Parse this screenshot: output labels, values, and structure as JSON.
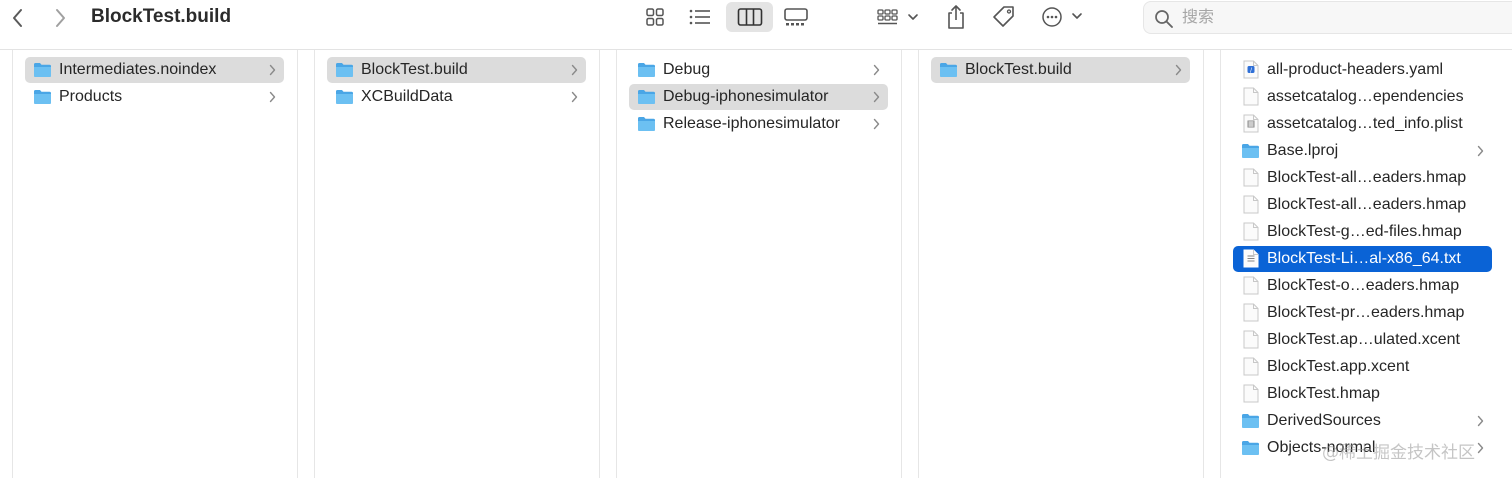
{
  "window": {
    "title": "BlockTest.build"
  },
  "toolbar": {
    "back_icon": "chevron-left-icon",
    "forward_icon": "chevron-right-icon",
    "view_icons": [
      "icon-view-icon",
      "list-view-icon",
      "column-view-icon",
      "gallery-view-icon"
    ],
    "active_view": "column-view-icon",
    "group_icon": "group-by-icon",
    "share_icon": "share-icon",
    "tag_icon": "tag-icon",
    "more_icon": "more-actions-icon"
  },
  "search": {
    "placeholder": "搜索"
  },
  "columns": [
    {
      "items": [
        {
          "label": "Intermediates.noindex",
          "type": "folder",
          "chevron": true,
          "state": "selected-gray"
        },
        {
          "label": "Products",
          "type": "folder",
          "chevron": true,
          "state": "none"
        }
      ]
    },
    {
      "items": [
        {
          "label": "BlockTest.build",
          "type": "folder",
          "chevron": true,
          "state": "selected-gray"
        },
        {
          "label": "XCBuildData",
          "type": "folder",
          "chevron": true,
          "state": "none"
        }
      ]
    },
    {
      "items": [
        {
          "label": "Debug",
          "type": "folder",
          "chevron": true,
          "state": "none"
        },
        {
          "label": "Debug-iphonesimulator",
          "type": "folder",
          "chevron": true,
          "state": "selected-gray"
        },
        {
          "label": "Release-iphonesimulator",
          "type": "folder",
          "chevron": true,
          "state": "none"
        }
      ]
    },
    {
      "items": [
        {
          "label": "BlockTest.build",
          "type": "folder",
          "chevron": true,
          "state": "selected-gray"
        }
      ]
    },
    {
      "items": [
        {
          "label": "all-product-headers.yaml",
          "type": "yaml",
          "chevron": false,
          "state": "none"
        },
        {
          "label": "assetcatalog…ependencies",
          "type": "file",
          "chevron": false,
          "state": "none"
        },
        {
          "label": "assetcatalog…ted_info.plist",
          "type": "plist",
          "chevron": false,
          "state": "none"
        },
        {
          "label": "Base.lproj",
          "type": "folder",
          "chevron": true,
          "state": "none"
        },
        {
          "label": "BlockTest-all…eaders.hmap",
          "type": "file",
          "chevron": false,
          "state": "none"
        },
        {
          "label": "BlockTest-all…eaders.hmap",
          "type": "file",
          "chevron": false,
          "state": "none"
        },
        {
          "label": "BlockTest-g…ed-files.hmap",
          "type": "file",
          "chevron": false,
          "state": "none"
        },
        {
          "label": "BlockTest-Li…al-x86_64.txt",
          "type": "text",
          "chevron": false,
          "state": "selected-blue"
        },
        {
          "label": "BlockTest-o…eaders.hmap",
          "type": "file",
          "chevron": false,
          "state": "none"
        },
        {
          "label": "BlockTest-pr…eaders.hmap",
          "type": "file",
          "chevron": false,
          "state": "none"
        },
        {
          "label": "BlockTest.ap…ulated.xcent",
          "type": "file",
          "chevron": false,
          "state": "none"
        },
        {
          "label": "BlockTest.app.xcent",
          "type": "file",
          "chevron": false,
          "state": "none"
        },
        {
          "label": "BlockTest.hmap",
          "type": "file",
          "chevron": false,
          "state": "none"
        },
        {
          "label": "DerivedSources",
          "type": "folder",
          "chevron": true,
          "state": "none"
        },
        {
          "label": "Objects-normal",
          "type": "folder",
          "chevron": true,
          "state": "none"
        }
      ]
    }
  ],
  "watermark": "@稀土掘金技术社区",
  "colors": {
    "selection_blue": "#0a63d6",
    "selection_gray": "#dcdcdc",
    "folder_blue": "#5ab4ec"
  }
}
